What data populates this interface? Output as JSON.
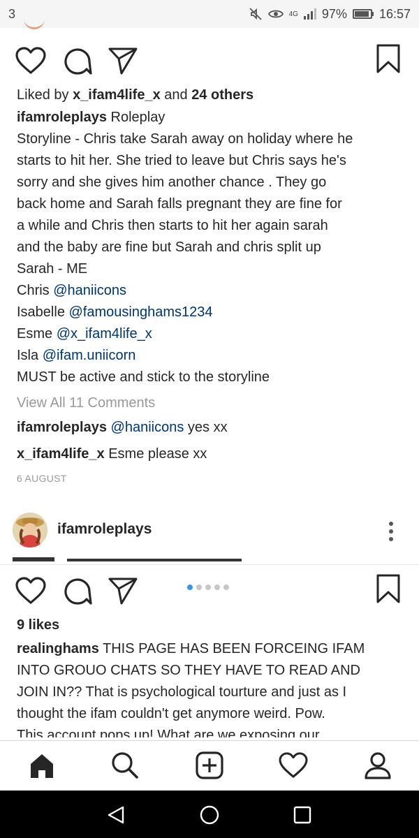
{
  "status_bar": {
    "notification_count": "3",
    "network": "4G",
    "battery": "97%",
    "time": "16:57"
  },
  "post1": {
    "liked_by_prefix": "Liked by ",
    "liked_by_user": "x_ifam4life_x",
    "liked_by_and": " and ",
    "liked_by_others": "24 others",
    "caption_user": "ifamroleplays",
    "caption_first": " Roleplay",
    "caption_lines": [
      "Storyline - Chris take Sarah away on holiday where he",
      "starts to hit her. She tried to leave but Chris says he's",
      "sorry and she gives him another chance . They go",
      "back home and Sarah falls pregnant they are fine for",
      "a while and Chris then starts to hit her again sarah",
      "and the baby are fine but Sarah and chris split up",
      "Sarah - ME"
    ],
    "cast": [
      {
        "role": "Chris ",
        "handle": "@haniicons"
      },
      {
        "role": "Isabelle ",
        "handle": "@famousinghams1234"
      },
      {
        "role": "Esme ",
        "handle": "@x_ifam4life_x"
      },
      {
        "role": "Isla ",
        "handle": "@ifam.uniicorn"
      }
    ],
    "caption_last": "MUST be active and stick to the storyline",
    "view_comments": "View All 11 Comments",
    "comments": [
      {
        "user": "ifamroleplays",
        "mention": "@haniicons",
        "text": " yes xx"
      },
      {
        "user": "x_ifam4life_x",
        "mention": "",
        "text": " Esme please xx"
      }
    ],
    "date": "6 AUGUST"
  },
  "post2": {
    "username": "ifamroleplays",
    "carousel_count": 5,
    "carousel_active": 0,
    "likes": "9 likes",
    "caption_user": "realinghams",
    "caption_first": " THIS PAGE HAS BEEN FORCEING IFAM",
    "caption_lines": [
      "INTO GROUO CHATS SO THEY HAVE TO READ AND",
      "JOIN IN?? That is psychological tourture and just as I",
      "thought the ifam couldn't get anymore weird. Pow.",
      "This account pops up! What are we exposing our"
    ]
  },
  "icons": {
    "like": "heart-icon",
    "comment": "comment-icon",
    "share": "send-icon",
    "save": "bookmark-icon",
    "home": "home-icon",
    "search": "search-icon",
    "add": "add-post-icon",
    "activity": "heart-icon",
    "profile": "profile-icon"
  },
  "colors": {
    "link": "#003569",
    "muted": "#999999",
    "carousel_active": "#3897f0"
  }
}
